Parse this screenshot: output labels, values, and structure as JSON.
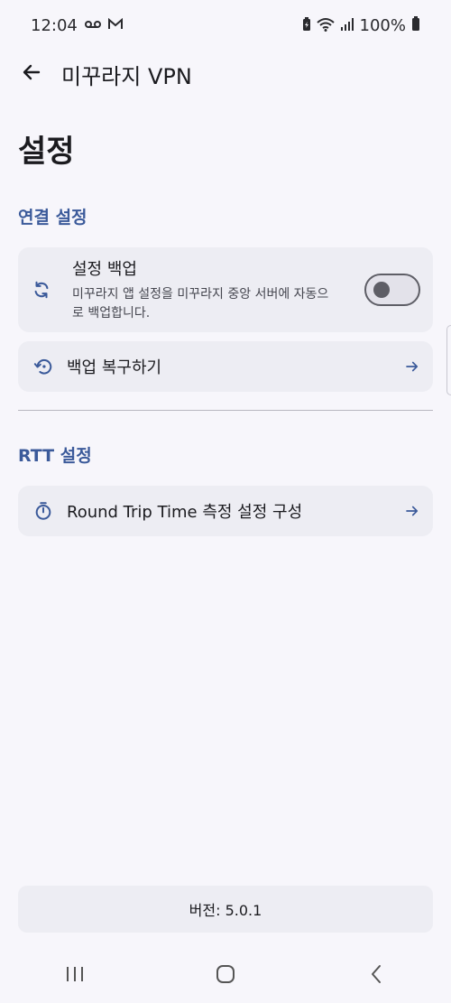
{
  "status_bar": {
    "time": "12:04",
    "battery": "100%",
    "icons": [
      "voicemail-icon",
      "gmail-icon",
      "battery-saver-icon",
      "wifi-icon",
      "signal-icon",
      "battery-icon"
    ]
  },
  "app_bar": {
    "title": "미꾸라지 VPN",
    "back_icon": "arrow-back-icon"
  },
  "page": {
    "title": "설정"
  },
  "sections": {
    "connection": {
      "header": "연결 설정",
      "backup": {
        "title": "설정 백업",
        "description": "미꾸라지 앱 설정을 미꾸라지 중앙 서버에 자동으로 백업합니다.",
        "toggle_on": false,
        "icon": "sync-icon"
      },
      "restore": {
        "label": "백업 복구하기",
        "icon": "restore-icon"
      }
    },
    "rtt": {
      "header": "RTT 설정",
      "configure": {
        "label": "Round Trip Time 측정 설정 구성",
        "icon": "timer-icon"
      }
    }
  },
  "footer": {
    "version": "버전: 5.0.1"
  },
  "colors": {
    "accent": "#3b5a9a",
    "background": "#f7f6fb",
    "card": "#ededf3"
  }
}
